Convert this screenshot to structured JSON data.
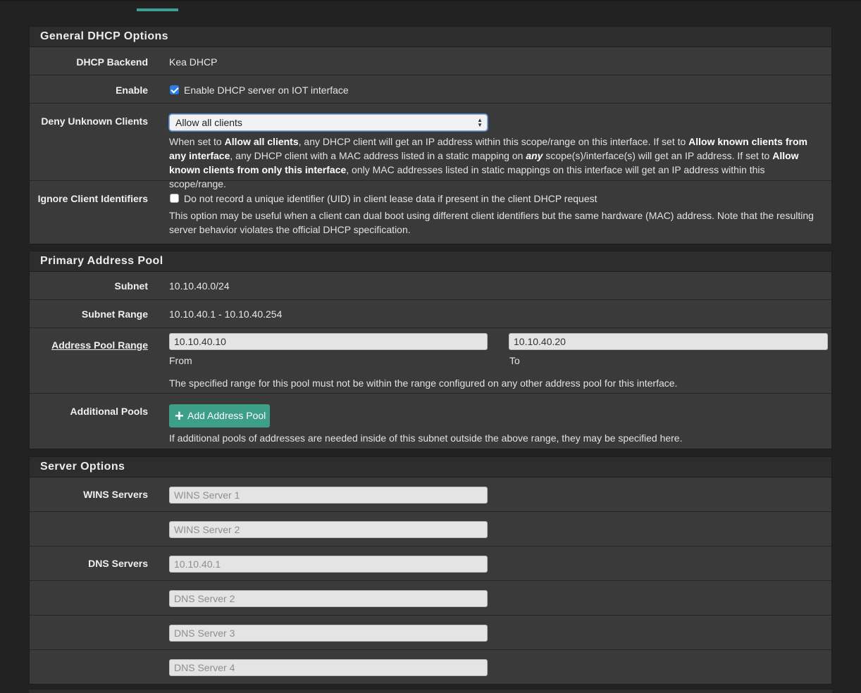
{
  "general": {
    "title": "General DHCP Options",
    "backend_label": "DHCP Backend",
    "backend_value": "Kea DHCP",
    "enable_label": "Enable",
    "enable_text": "Enable DHCP server on IOT interface",
    "enable_checked": true,
    "deny_label": "Deny Unknown Clients",
    "deny_selected": "Allow all clients",
    "deny_help": {
      "p1": "When set to ",
      "b1": "Allow all clients",
      "p2": ", any DHCP client will get an IP address within this scope/range on this interface. If set to ",
      "b2": "Allow known clients from any interface",
      "p3": ", any DHCP client with a MAC address listed in a static mapping on ",
      "bi": "any",
      "p4": " scope(s)/interface(s) will get an IP address. If set to ",
      "b3": "Allow known clients from only this interface",
      "p5": ", only MAC addresses listed in static mappings on this interface will get an IP address within this scope/range."
    },
    "ignore_label": "Ignore Client Identifiers",
    "ignore_text": "Do not record a unique identifier (UID) in client lease data if present in the client DHCP request",
    "ignore_checked": false,
    "ignore_help": "This option may be useful when a client can dual boot using different client identifiers but the same hardware (MAC) address. Note that the resulting server behavior violates the official DHCP specification."
  },
  "pool": {
    "title": "Primary Address Pool",
    "subnet_label": "Subnet",
    "subnet_value": "10.10.40.0/24",
    "range_label": "Subnet Range",
    "range_value": "10.10.40.1 - 10.10.40.254",
    "pool_range_label": "Address Pool Range",
    "from_value": "10.10.40.10",
    "from_label": "From",
    "to_value": "10.10.40.20",
    "to_label": "To",
    "pool_help": "The specified range for this pool must not be within the range configured on any other address pool for this interface.",
    "additional_label": "Additional Pools",
    "add_button": "Add Address Pool",
    "additional_help": "If additional pools of addresses are needed inside of this subnet outside the above range, they may be specified here."
  },
  "server": {
    "title": "Server Options",
    "wins_label": "WINS Servers",
    "wins1_placeholder": "WINS Server 1",
    "wins2_placeholder": "WINS Server 2",
    "dns_label": "DNS Servers",
    "dns1_placeholder": "10.10.40.1",
    "dns2_placeholder": "DNS Server 2",
    "dns3_placeholder": "DNS Server 3",
    "dns4_placeholder": "DNS Server 4"
  },
  "colors": {
    "accent": "#3d9f88",
    "panel_bg": "#3a3a3a",
    "header_bg": "#2d2d2d",
    "page_bg": "#222222"
  },
  "icons": {
    "add": "plus-icon",
    "checkbox_checked": "checkbox-checked-icon",
    "select_arrows": "chevron-updown-icon"
  }
}
